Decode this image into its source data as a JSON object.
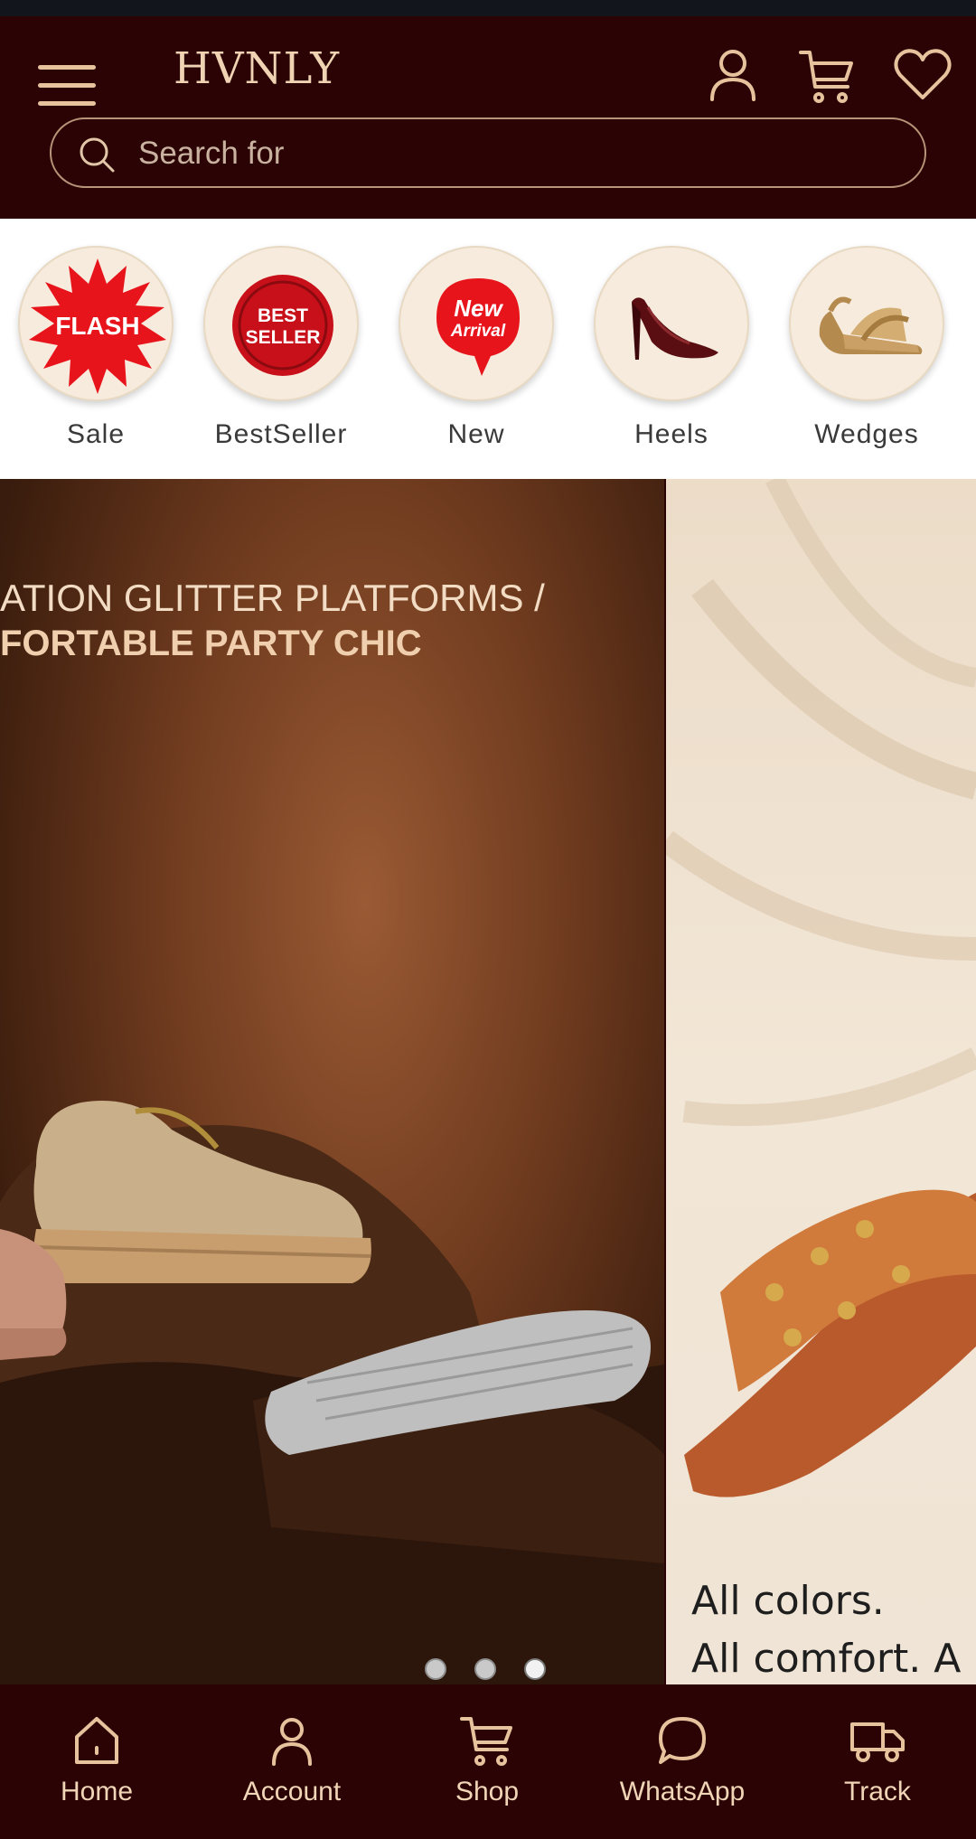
{
  "header": {
    "logo": "HVNLY",
    "icons": [
      "menu-icon",
      "user-icon",
      "cart-icon",
      "heart-icon"
    ],
    "search_placeholder": "Search for"
  },
  "categories": [
    {
      "label": "Sale",
      "badge": "FLASH"
    },
    {
      "label": "BestSeller",
      "badge_line1": "BEST",
      "badge_line2": "SELLER"
    },
    {
      "label": "New",
      "badge_line1": "New",
      "badge_line2": "Arrival"
    },
    {
      "label": "Heels"
    },
    {
      "label": "Wedges"
    }
  ],
  "banner": {
    "slide1_line1": "ATION GLITTER PLATFORMS /",
    "slide1_line2": "FORTABLE PARTY CHIC",
    "slide2_line1": "All colors.",
    "slide2_line2": "All comfort. A",
    "dots": 3,
    "active_dot": 3
  },
  "bottom_nav": [
    {
      "label": "Home",
      "icon": "home-icon"
    },
    {
      "label": "Account",
      "icon": "user-icon"
    },
    {
      "label": "Shop",
      "icon": "cart-icon"
    },
    {
      "label": "WhatsApp",
      "icon": "chat-bubble-icon"
    },
    {
      "label": "Track",
      "icon": "truck-icon"
    }
  ],
  "colors": {
    "header_bg": "#2b0305",
    "accent": "#e7c39d",
    "badge_red": "#e8141c"
  }
}
